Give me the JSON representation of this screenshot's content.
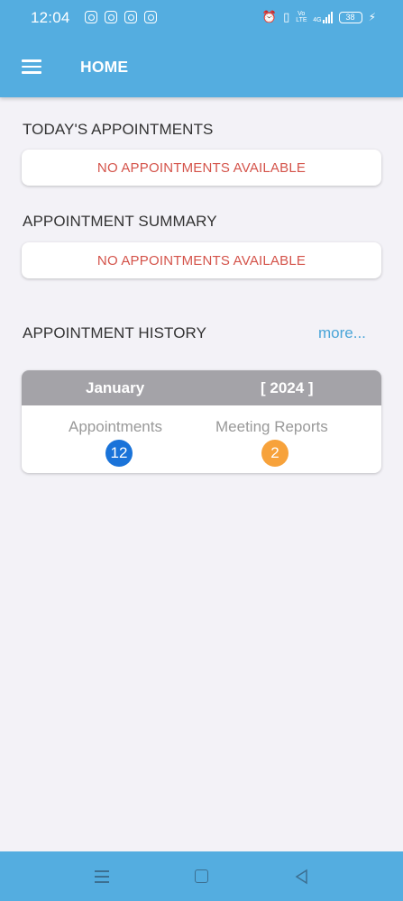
{
  "status_bar": {
    "time": "12:04",
    "notification_icons": [
      "instagram-icon",
      "instagram-icon",
      "instagram-icon",
      "instagram-icon"
    ],
    "system_icons": [
      "alarm-icon",
      "vibrate-icon",
      "volte-icon",
      "signal-icon",
      "battery-icon",
      "charging-icon"
    ],
    "volte_label": "Vo LTE",
    "signal_label": "4G",
    "battery_level": "38"
  },
  "app_bar": {
    "title": "HOME",
    "menu_icon": "hamburger-menu-icon",
    "color": "#54ade0"
  },
  "todays_appointments": {
    "title": "TODAY'S APPOINTMENTS",
    "empty_message": "NO APPOINTMENTS AVAILABLE"
  },
  "appointment_summary": {
    "title": "APPOINTMENT SUMMARY",
    "empty_message": "NO APPOINTMENTS AVAILABLE"
  },
  "appointment_history": {
    "title": "APPOINTMENT HISTORY",
    "more_label": "more...",
    "month": "January",
    "year": "[ 2024 ]",
    "appointments_label": "Appointments",
    "appointments_count": "12",
    "appointments_color": "#1a73d9",
    "meeting_reports_label": "Meeting Reports",
    "meeting_reports_count": "2",
    "meeting_reports_color": "#f7a23b"
  },
  "nav_bar": {
    "buttons": [
      "menu-icon",
      "home-square-icon",
      "back-triangle-icon"
    ]
  }
}
